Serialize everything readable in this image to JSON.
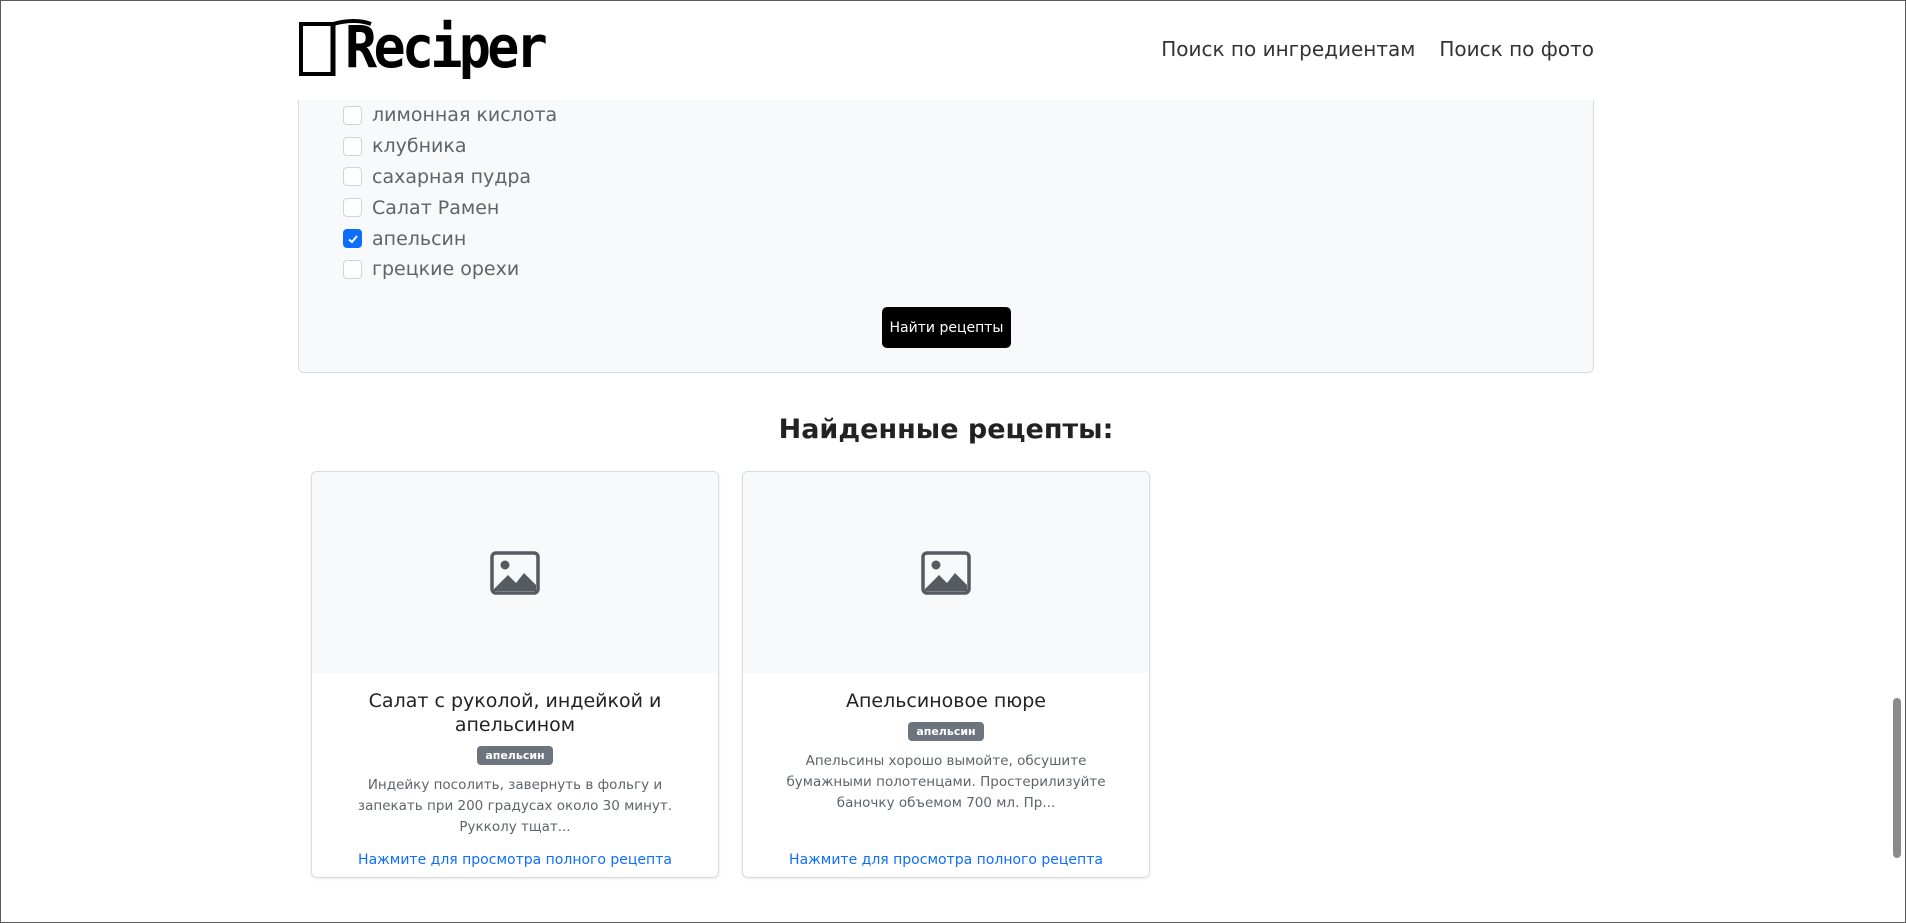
{
  "header": {
    "logo_text": "Reciper",
    "nav": [
      "Поиск по ингредиентам",
      "Поиск по фото"
    ]
  },
  "ingredients": [
    {
      "label": "лимонная кислота",
      "checked": false
    },
    {
      "label": "клубника",
      "checked": false
    },
    {
      "label": "сахарная пудра",
      "checked": false
    },
    {
      "label": "Салат Рамен",
      "checked": false
    },
    {
      "label": "апельсин",
      "checked": true
    },
    {
      "label": "грецкие орехи",
      "checked": false
    }
  ],
  "find_button": "Найти рецепты",
  "results": {
    "title": "Найденные рецепты:",
    "cards": [
      {
        "title": "Салат с руколой, индейкой и апельсином",
        "badge": "апельсин",
        "description": "Индейку посолить, завернуть в фольгу и запекать при 200 градусах около 30 минут. Рукколу тщат...",
        "link": "Нажмите для просмотра полного рецепта"
      },
      {
        "title": "Апельсиновое пюре",
        "badge": "апельсин",
        "description": "Апельсины хорошо вымойте, обсушите бумажными полотенцами. Простерилизуйте баночку объемом 700 мл. Пр...",
        "link": "Нажмите для просмотра полного рецепта"
      }
    ]
  },
  "colors": {
    "accent": "#0d6efd",
    "badge": "#6c757d",
    "panel_bg": "#f8f9fa"
  }
}
